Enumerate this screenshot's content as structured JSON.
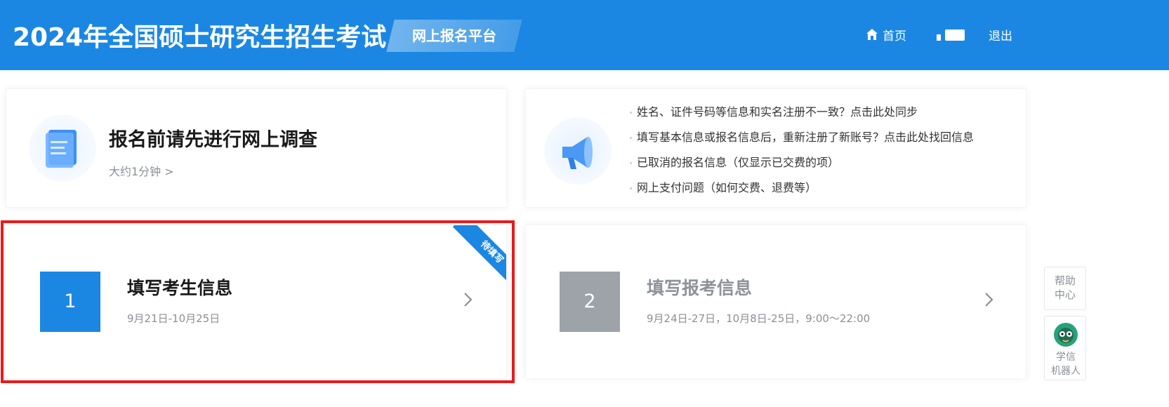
{
  "header": {
    "title": "2024年全国硕士研究生招生考试",
    "platform": "网上报名平台",
    "nav_home": "首页",
    "nav_logout": "退出",
    "home_icon": "home-icon",
    "user_icon": "user-card-icon",
    "bg_color": "#1b87e3"
  },
  "survey": {
    "title": "报名前请先进行网上调查",
    "subtitle": "大约1分钟 >",
    "icon": "document-icon"
  },
  "notice": {
    "icon": "megaphone-icon",
    "items": [
      "姓名、证件号码等信息和实名注册不一致？点击此处同步",
      "填写基本信息或报名信息后，重新注册了新账号？点击此处找回信息",
      "已取消的报名信息（仅显示已交费的项）",
      "网上支付问题（如何交费、退费等）"
    ]
  },
  "steps": [
    {
      "number": "1",
      "title": "填写考生信息",
      "date": "9月21日-10月25日",
      "ribbon": "待填写",
      "active_color": "#1b87e3"
    },
    {
      "number": "2",
      "title": "填写报考信息",
      "date": "9月24日-27日，10月8日-25日，9:00～22:00",
      "disabled_color": "#9ea2a9"
    }
  ],
  "sidebar": {
    "help_line1": "帮助",
    "help_line2": "中心",
    "robot_line1": "学信",
    "robot_line2": "机器人",
    "robot_icon": "robot-icon"
  },
  "highlight_color": "#e81b1b"
}
